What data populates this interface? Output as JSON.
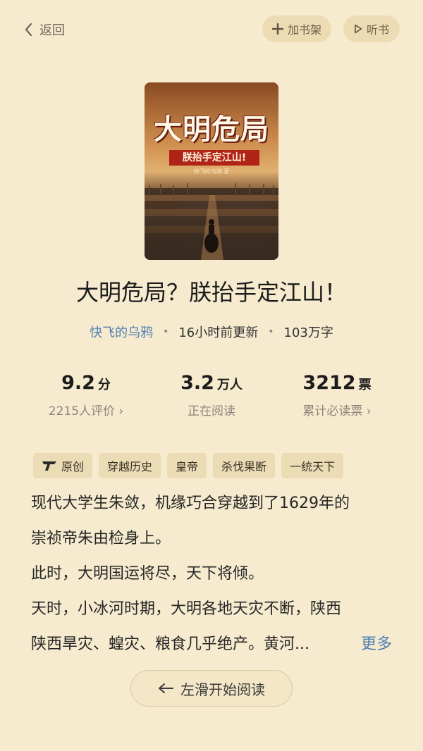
{
  "header": {
    "back_label": "返回",
    "add_shelf_label": "加书架",
    "listen_label": "听书"
  },
  "book": {
    "cover": {
      "title": "大明危局",
      "subtitle": "朕抬手定江山!",
      "author": "快飞的乌鸦 著"
    },
    "title": "大明危局？朕抬手定江山！",
    "author": "快飞的乌鸦",
    "updated": "16小时前更新",
    "word_count": "103万字"
  },
  "stats": [
    {
      "value": "9.2",
      "unit": "分",
      "label": "2215人评价 ›"
    },
    {
      "value": "3.2",
      "unit": "万人",
      "label": "正在阅读"
    },
    {
      "value": "3212",
      "unit": "票",
      "label": "累计必读票 ›"
    }
  ],
  "tags": [
    "原创",
    "穿越历史",
    "皇帝",
    "杀伐果断",
    "一统天下"
  ],
  "description": {
    "lines": [
      "现代大学生朱敛，机缘巧合穿越到了1629年的",
      "崇祯帝朱由检身上。",
      "此时，大明国运将尽，天下将倾。",
      "天时，小冰河时期，大明各地天灾不断，陕西",
      "陕西旱灾、蝗灾、粮食几乎绝产。黄河..."
    ],
    "more_label": "更多"
  },
  "start_reading_label": "左滑开始阅读",
  "colors": {
    "background": "#f6ebcf",
    "accent_link": "#4f7fb0",
    "pill_bg": "#eddcb3"
  }
}
